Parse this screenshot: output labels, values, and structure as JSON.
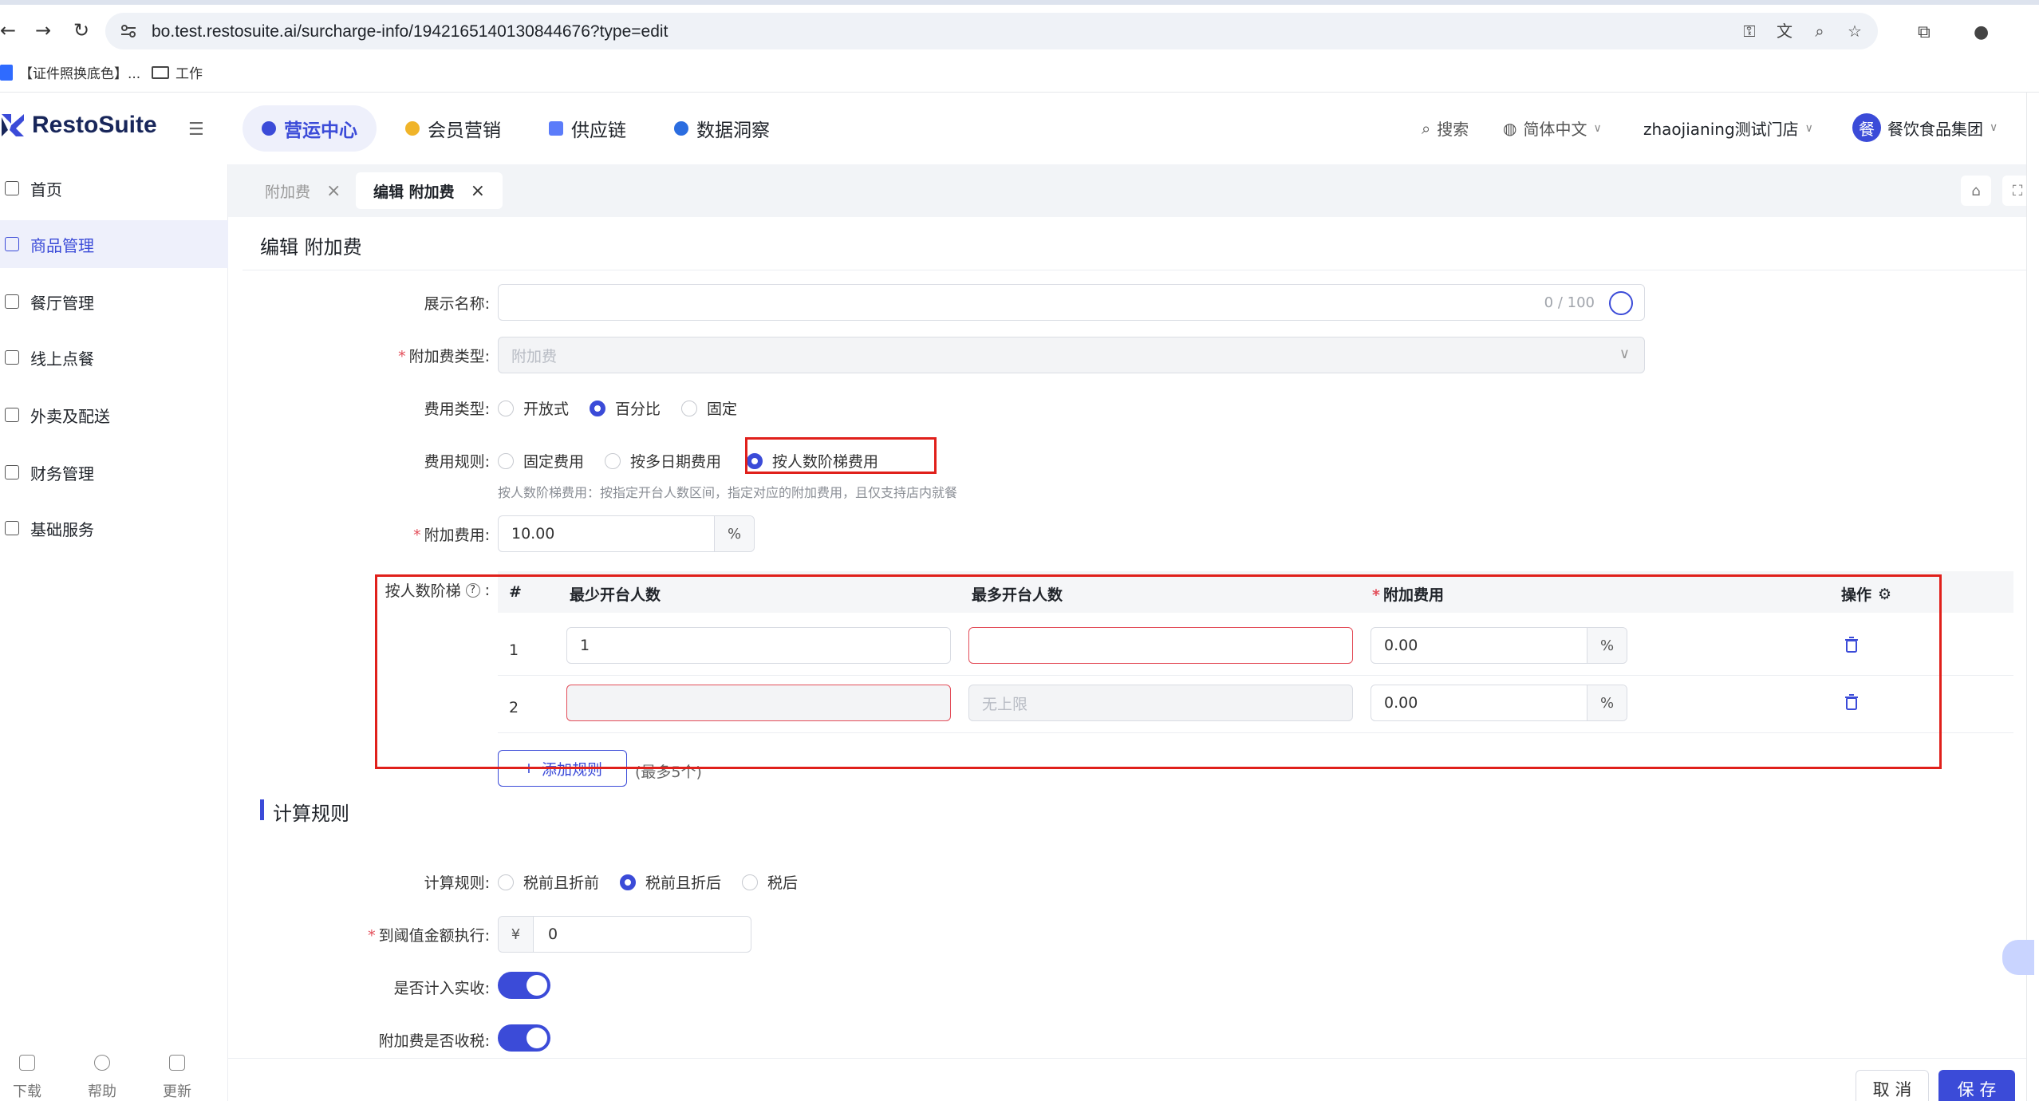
{
  "browser": {
    "url": "bo.test.restosuite.ai/surcharge-info/1942165140130844676?type=edit",
    "bookmarks": [
      "【证件照换底色】...",
      "工作"
    ]
  },
  "header": {
    "brand": "RestoSuite",
    "nav": [
      {
        "label": "营运中心",
        "active": true
      },
      {
        "label": "会员营销",
        "active": false
      },
      {
        "label": "供应链",
        "active": false
      },
      {
        "label": "数据洞察",
        "active": false
      }
    ],
    "search_label": "搜索",
    "language_label": "简体中文",
    "store_label": "zhaojianing测试门店",
    "avatar_text": "餐",
    "org_label": "餐饮食品集团"
  },
  "sidebar": {
    "items": [
      {
        "label": "首页",
        "active": false
      },
      {
        "label": "商品管理",
        "active": true
      },
      {
        "label": "餐厅管理",
        "active": false
      },
      {
        "label": "线上点餐",
        "active": false
      },
      {
        "label": "外卖及配送",
        "active": false
      },
      {
        "label": "财务管理",
        "active": false
      },
      {
        "label": "基础服务",
        "active": false
      }
    ],
    "footer": [
      "下载",
      "帮助",
      "更新"
    ]
  },
  "tabs": [
    {
      "label": "附加费",
      "active": false
    },
    {
      "label": "编辑 附加费",
      "active": true
    }
  ],
  "page": {
    "title": "编辑 附加费",
    "form": {
      "display_name": {
        "label": "展示名称:",
        "value": "",
        "counter": "0 / 100"
      },
      "surcharge_type": {
        "label": "附加费类型:",
        "placeholder": "附加费"
      },
      "fee_type": {
        "label": "费用类型:",
        "options": [
          "开放式",
          "百分比",
          "固定"
        ],
        "selected": "百分比"
      },
      "fee_rule": {
        "label": "费用规则:",
        "options": [
          "固定费用",
          "按多日期费用",
          "按人数阶梯费用"
        ],
        "selected": "按人数阶梯费用",
        "help": "按人数阶梯费用：按指定开台人数区间，指定对应的附加费用，且仅支持店内就餐"
      },
      "surcharge_fee": {
        "label": "附加费用:",
        "value": "10.00",
        "unit": "%"
      },
      "tier": {
        "label": "按人数阶梯",
        "columns": [
          "#",
          "最少开台人数",
          "最多开台人数",
          "附加费用",
          "操作"
        ],
        "rows": [
          {
            "index": "1",
            "min": "1",
            "max": "",
            "max_placeholder": "",
            "fee": "0.00",
            "unit": "%"
          },
          {
            "index": "2",
            "min": "",
            "max": "",
            "max_placeholder": "无上限",
            "fee": "0.00",
            "unit": "%"
          }
        ],
        "add_label": "添加规则",
        "add_note": "(最多5个)"
      }
    },
    "calc_section": {
      "title": "计算规则",
      "calc_rule": {
        "label": "计算规则:",
        "options": [
          "税前且折前",
          "税前且折后",
          "税后"
        ],
        "selected": "税前且折后"
      },
      "threshold": {
        "label": "到阈值金额执行:",
        "prefix": "¥",
        "value": "0"
      },
      "count_revenue": {
        "label": "是否计入实收:",
        "on": true
      },
      "taxable": {
        "label": "附加费是否收税:",
        "on": true
      }
    },
    "footer": {
      "cancel_label": "取 消",
      "save_label": "保 存"
    }
  },
  "colors": {
    "accent": "#3b4bd8",
    "highlight": "#e0201b",
    "error": "#e34d59"
  }
}
